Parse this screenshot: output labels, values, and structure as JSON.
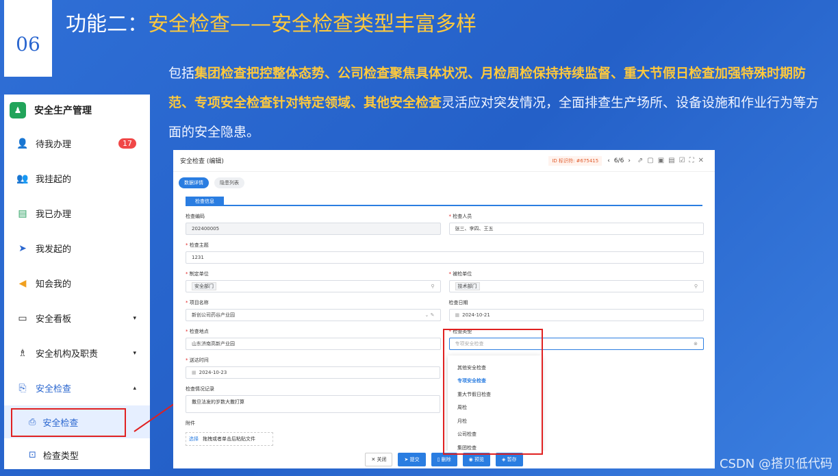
{
  "slide": {
    "number": "06",
    "title_prefix": "功能二：",
    "title_highlight": "安全检查——安全检查类型丰富多样",
    "desc_parts": [
      {
        "t": "包括",
        "y": false
      },
      {
        "t": "集团检查把控整体态势、公司检查聚焦具体状况、月检周检保持持续监督、重大节假日检查加强特殊时期防范、专项安全检查针对特定领域、其他安全检查",
        "y": true
      },
      {
        "t": "灵活应对突发情况，全面排查生产场所、设备设施和作业行为等方面的安全隐患。",
        "y": false
      }
    ],
    "watermark": "CSDN @搭贝低代码"
  },
  "sidebar": {
    "app_name": "安全生产管理",
    "items": [
      {
        "label": "待我办理",
        "icon": "user-icon",
        "badge": "17"
      },
      {
        "label": "我挂起的",
        "icon": "user-pause-icon"
      },
      {
        "label": "我已办理",
        "icon": "done-list-icon"
      },
      {
        "label": "我发起的",
        "icon": "send-icon"
      },
      {
        "label": "知会我的",
        "icon": "megaphone-icon"
      },
      {
        "label": "安全看板",
        "icon": "folder-icon",
        "caret": "▾"
      },
      {
        "label": "安全机构及职责",
        "icon": "org-icon",
        "caret": "▾"
      },
      {
        "label": "安全检查",
        "icon": "inspect-icon",
        "caret": "▴"
      }
    ],
    "subitems": [
      {
        "label": "安全检查",
        "icon": "inspect-doc-icon"
      },
      {
        "label": "检查类型",
        "icon": "type-icon"
      }
    ]
  },
  "form": {
    "window_title": "安全检查 (编辑)",
    "id_tag": "ID 标识符: #675415",
    "pager": "6/6",
    "tabs": [
      "数据详情",
      "隐患列表"
    ],
    "section": "检查信息",
    "fields": {
      "code_label": "检查编码",
      "code_value": "202400005",
      "people_label": "检查人员",
      "people_value": "张三、李四、王五",
      "topic_label": "检查主题",
      "topic_value": "1231",
      "unit_label": "制定单位",
      "unit_value": "安全部门",
      "checked_label": "被检单位",
      "checked_value": "技术部门",
      "project_label": "项目名称",
      "project_value": "新创公司药谷产业园",
      "date_label": "检查日期",
      "date_value": "2024-10-21",
      "place_label": "检查地点",
      "place_value": "山东济南高新产业园",
      "type_label": "检查类型",
      "type_placeholder": "专项安全检查",
      "deliver_label": "送达时间",
      "deliver_value": "2024-10-23",
      "record_label": "检查情况记录",
      "record_value": "撒旦法发的岁数大撒打算",
      "attach_label": "附件",
      "attach_choose": "选择",
      "attach_hint": "拖拽或者单击后粘贴文件"
    },
    "dropdown": [
      "其他安全检查",
      "专项安全检查",
      "重大节假日检查",
      "周检",
      "月检",
      "公司检查",
      "集团检查"
    ],
    "dropdown_selected": 1,
    "footer": [
      "关闭",
      "提交",
      "删除",
      "预览",
      "暂存"
    ]
  }
}
